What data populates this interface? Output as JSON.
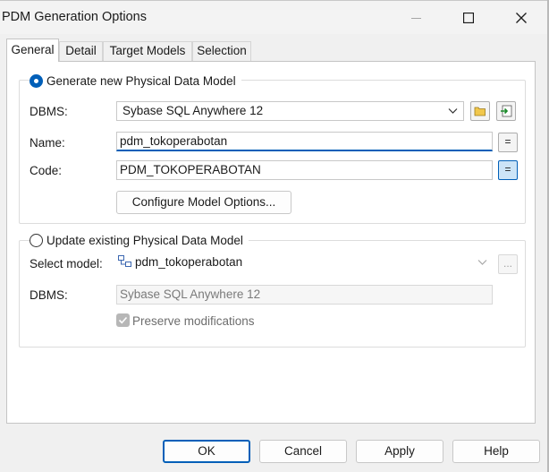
{
  "window": {
    "title": "PDM Generation Options"
  },
  "tabs": [
    {
      "label": "General",
      "active": true
    },
    {
      "label": "Detail"
    },
    {
      "label": "Target Models"
    },
    {
      "label": "Selection"
    }
  ],
  "generate_group": {
    "radio_label": "Generate new Physical Data Model",
    "selected": true,
    "dbms_label": "DBMS:",
    "dbms_value": "Sybase SQL Anywhere 12",
    "name_label": "Name:",
    "name_value": "pdm_tokoperabotan",
    "code_label": "Code:",
    "code_value": "PDM_TOKOPERABOTAN",
    "equals_symbol": "=",
    "configure_button": "Configure Model Options..."
  },
  "update_group": {
    "radio_label": "Update existing Physical Data Model",
    "selected": false,
    "select_model_label": "Select model:",
    "select_model_value": "pdm_tokoperabotan",
    "browse_label": "...",
    "dbms_label": "DBMS:",
    "dbms_value": "Sybase SQL Anywhere 12",
    "preserve_label": "Preserve modifications",
    "preserve_checked": true
  },
  "footer": {
    "ok": "OK",
    "cancel": "Cancel",
    "apply": "Apply",
    "help": "Help"
  },
  "colors": {
    "accent": "#005fb8",
    "dialog_bg": "#f0f0f0",
    "panel_bg": "#ffffff"
  }
}
